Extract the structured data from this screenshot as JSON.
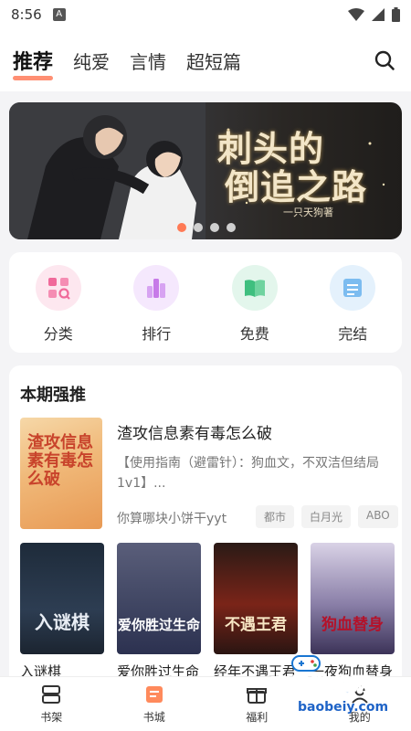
{
  "status_bar": {
    "time": "8:56",
    "notification_letter": "A"
  },
  "nav": {
    "tabs": [
      "推荐",
      "纯爱",
      "言情",
      "超短篇"
    ],
    "active_tab": 0,
    "search_icon": "search-icon"
  },
  "banner": {
    "title_line1": "刺头的",
    "title_line2": "倒追之路",
    "author": "一只天狗著",
    "page_count": 4,
    "active_page": 0
  },
  "quick_links": [
    {
      "label": "分类",
      "icon": "category-icon",
      "color": "#f06a9a"
    },
    {
      "label": "排行",
      "icon": "ranking-icon",
      "color": "#c77ae8"
    },
    {
      "label": "免费",
      "icon": "free-book-icon",
      "color": "#3fbf7f"
    },
    {
      "label": "完结",
      "icon": "completed-icon",
      "color": "#4aa3e8"
    }
  ],
  "recommend": {
    "section_title": "本期强推",
    "featured": {
      "cover_text": "渣攻信息素有毒怎么破",
      "title": "渣攻信息素有毒怎么破",
      "description": "【使用指南（避雷针）：狗血文，不双洁但结局1v1】...",
      "author": "你算哪块小饼干yyt",
      "tags": [
        "都市",
        "白月光",
        "ABO"
      ]
    },
    "books": [
      {
        "title": "入谜棋",
        "cover_text": "入谜棋"
      },
      {
        "title": "爱你胜过生命",
        "cover_text": "爱你胜过生命"
      },
      {
        "title": "经年不遇王君",
        "cover_text": "不遇王君"
      },
      {
        "title": "一夜狗血替身",
        "cover_text": "狗血替身"
      }
    ]
  },
  "bottom_nav": [
    {
      "label": "书架",
      "icon": "bookshelf-icon"
    },
    {
      "label": "书城",
      "icon": "bookstore-icon"
    },
    {
      "label": "福利",
      "icon": "gift-icon"
    },
    {
      "label": "我的",
      "icon": "profile-icon"
    }
  ],
  "watermark": {
    "title": "宝贝游戏网",
    "url": "baobeiy.com"
  },
  "colors": {
    "accent": "#ff7a55",
    "tab_underline": "#ff8f73",
    "background": "#f4f4f6"
  }
}
